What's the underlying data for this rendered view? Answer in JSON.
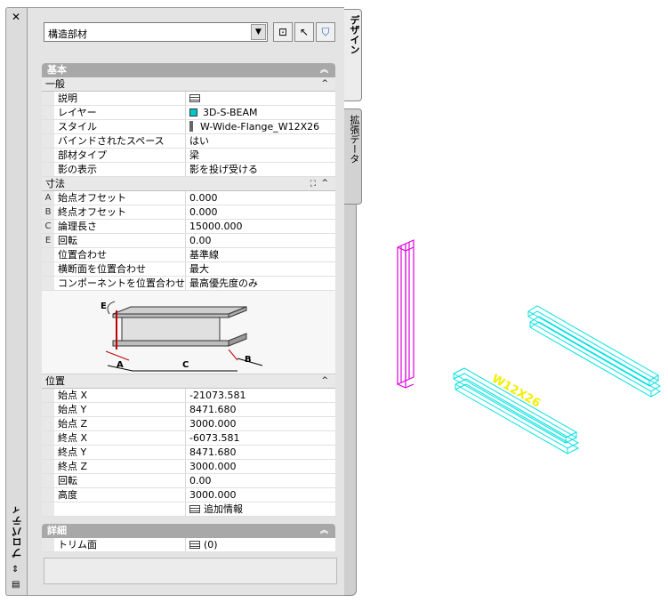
{
  "palette": {
    "vertical_title": "プロパティ",
    "tabs": {
      "design": "デザイン",
      "extended": "拡張データ"
    },
    "toolbar": {
      "selected_type": "構造部材"
    }
  },
  "categories": {
    "basic": "基本",
    "general": "一般",
    "dimensions": "寸法",
    "location": "位置",
    "detail": "詳細"
  },
  "general_rows": [
    {
      "label": "説明",
      "value": ""
    },
    {
      "label": "レイヤー",
      "value": "3D-S-BEAM",
      "swatch_color": "#00c8c8"
    },
    {
      "label": "スタイル",
      "value": "W-Wide-Flange_W12X26"
    },
    {
      "label": "バインドされたスペース",
      "value": "はい"
    },
    {
      "label": "部材タイプ",
      "value": "梁"
    },
    {
      "label": "影の表示",
      "value": "影を投げ受ける"
    }
  ],
  "dimension_rows": [
    {
      "mark": "A",
      "label": "始点オフセット",
      "value": "0.000"
    },
    {
      "mark": "B",
      "label": "終点オフセット",
      "value": "0.000"
    },
    {
      "mark": "C",
      "label": "論理長さ",
      "value": "15000.000"
    },
    {
      "mark": "E",
      "label": "回転",
      "value": "0.00"
    },
    {
      "mark": "",
      "label": "位置合わせ",
      "value": "基準線"
    },
    {
      "mark": "",
      "label": "横断面を位置合わせ",
      "value": "最大"
    },
    {
      "mark": "",
      "label": "コンポーネントを位置合わせ",
      "value": "最高優先度のみ"
    }
  ],
  "diagram_labels": {
    "a": "A",
    "b": "B",
    "c": "C",
    "e": "E"
  },
  "location_rows": [
    {
      "label": "始点 X",
      "value": "-21073.581"
    },
    {
      "label": "始点 Y",
      "value": "8471.680"
    },
    {
      "label": "始点 Z",
      "value": "3000.000"
    },
    {
      "label": "終点 X",
      "value": "-6073.581"
    },
    {
      "label": "終点 Y",
      "value": "8471.680"
    },
    {
      "label": "終点 Z",
      "value": "3000.000"
    },
    {
      "label": "回転",
      "value": "0.00"
    },
    {
      "label": "高度",
      "value": "3000.000"
    }
  ],
  "extra_info_label": "追加情報",
  "detail_rows": [
    {
      "label": "トリム面",
      "value": "(0)"
    }
  ],
  "drawing": {
    "beam_label": "W12X26",
    "colors": {
      "selected": "#e000e0",
      "beam": "#00e0e0",
      "label": "#f0f000"
    }
  }
}
